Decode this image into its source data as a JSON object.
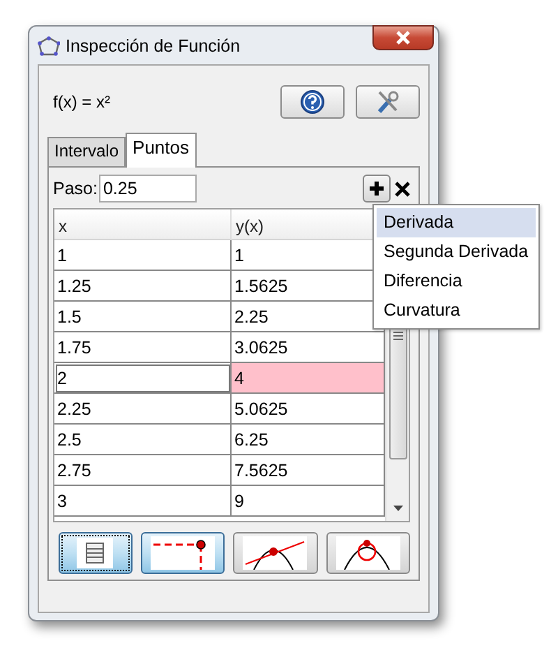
{
  "window": {
    "title": "Inspección de Función"
  },
  "function_label": "f(x) = x²",
  "tabs": [
    {
      "label": "Intervalo",
      "selected": false
    },
    {
      "label": "Puntos",
      "selected": true
    }
  ],
  "step": {
    "label": "Paso:",
    "value": "0.25"
  },
  "table": {
    "columns": [
      "x",
      "y(x)"
    ],
    "rows": [
      {
        "cells": [
          "1",
          "1"
        ],
        "selected": false
      },
      {
        "cells": [
          "1.25",
          "1.5625"
        ],
        "selected": false
      },
      {
        "cells": [
          "1.5",
          "2.25"
        ],
        "selected": false
      },
      {
        "cells": [
          "1.75",
          "3.0625"
        ],
        "selected": false
      },
      {
        "cells": [
          "2",
          "4"
        ],
        "selected": true
      },
      {
        "cells": [
          "2.25",
          "5.0625"
        ],
        "selected": false
      },
      {
        "cells": [
          "2.5",
          "6.25"
        ],
        "selected": false
      },
      {
        "cells": [
          "2.75",
          "7.5625"
        ],
        "selected": false
      },
      {
        "cells": [
          "3",
          "9"
        ],
        "selected": false
      }
    ]
  },
  "menu": {
    "items": [
      {
        "label": "Derivada",
        "selected": true
      },
      {
        "label": "Segunda Derivada",
        "selected": false
      },
      {
        "label": "Diferencia",
        "selected": false
      },
      {
        "label": "Curvatura",
        "selected": false
      }
    ]
  },
  "tool_buttons": [
    {
      "kind": "table",
      "selected": true
    },
    {
      "kind": "trace",
      "selected": true
    },
    {
      "kind": "tangent",
      "selected": false
    },
    {
      "kind": "osculating",
      "selected": false
    }
  ]
}
